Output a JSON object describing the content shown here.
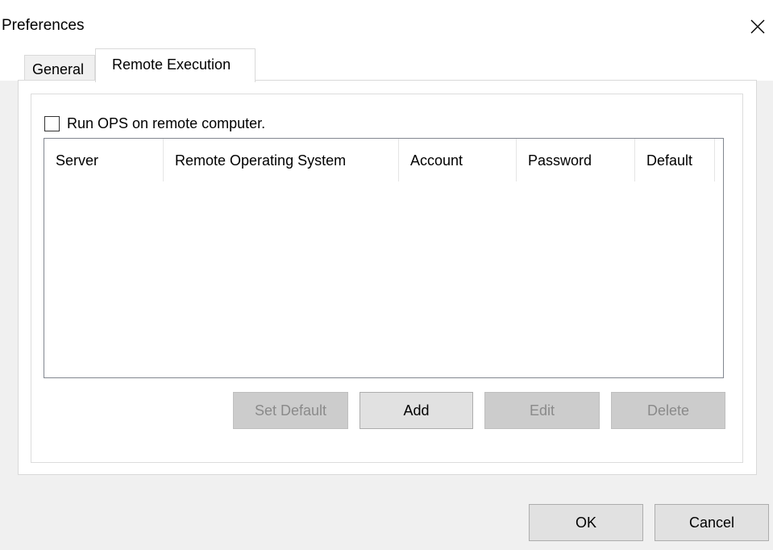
{
  "window": {
    "title": "Preferences"
  },
  "tabs": [
    {
      "label": "General"
    },
    {
      "label": "Remote Execution"
    }
  ],
  "remote": {
    "checkbox_label": "Run OPS on remote computer.",
    "checkbox_checked": false,
    "columns": [
      "Server",
      "Remote Operating System",
      "Account",
      "Password",
      "Default"
    ],
    "rows": [],
    "buttons": {
      "set_default": "Set Default",
      "add": "Add",
      "edit": "Edit",
      "delete": "Delete"
    }
  },
  "dialog_buttons": {
    "ok": "OK",
    "cancel": "Cancel"
  },
  "icons": {
    "close": "close-icon"
  }
}
